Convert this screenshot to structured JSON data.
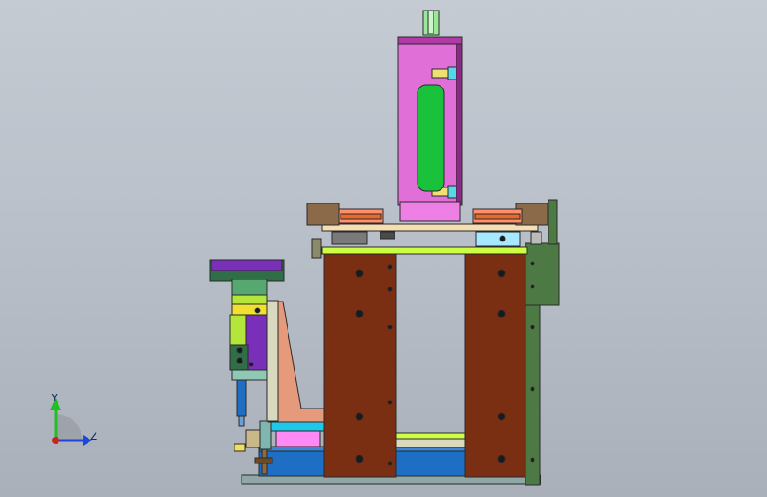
{
  "app": {
    "view": "cad-model-viewport"
  },
  "triad": {
    "y_label": "Y",
    "z_label": "Z"
  },
  "colors": {
    "background_top": "#c5cbd3",
    "background_bottom": "#a9b0ba",
    "brown_plate": "#7a2e12",
    "magenta_cylinder": "#e06fd8",
    "green_window": "#19c23a",
    "lime_plate": "#ccff44",
    "blue_base": "#1e6fc4",
    "dark_green_panel": "#4d7a44",
    "salmon_bracket": "#e59a7c",
    "purple_block": "#7a2fb8",
    "yellow_green_block": "#b3e53a",
    "tan_plate": "#f5deb3",
    "triad_y": "#21c021",
    "triad_z": "#1e46d8",
    "triad_origin": "#d02020"
  }
}
